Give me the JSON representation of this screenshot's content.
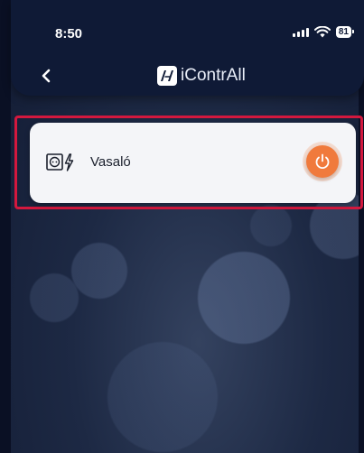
{
  "status_bar": {
    "time": "8:50",
    "battery": "81",
    "icons": [
      "signal-icon",
      "wifi-icon",
      "battery-icon"
    ]
  },
  "header": {
    "back_icon": "chevron-left-icon",
    "logo_mark": "iI",
    "logo_text": "iContrAll"
  },
  "devices": [
    {
      "icon": "socket-power-icon",
      "name": "Vasaló",
      "power_button_icon": "power-icon",
      "power_button_color": "#f07a3c"
    }
  ],
  "colors": {
    "header_bg": "#0f1a36",
    "card_bg": "#f4f5f8",
    "highlight": "#d3183e",
    "accent": "#f07a3c"
  }
}
